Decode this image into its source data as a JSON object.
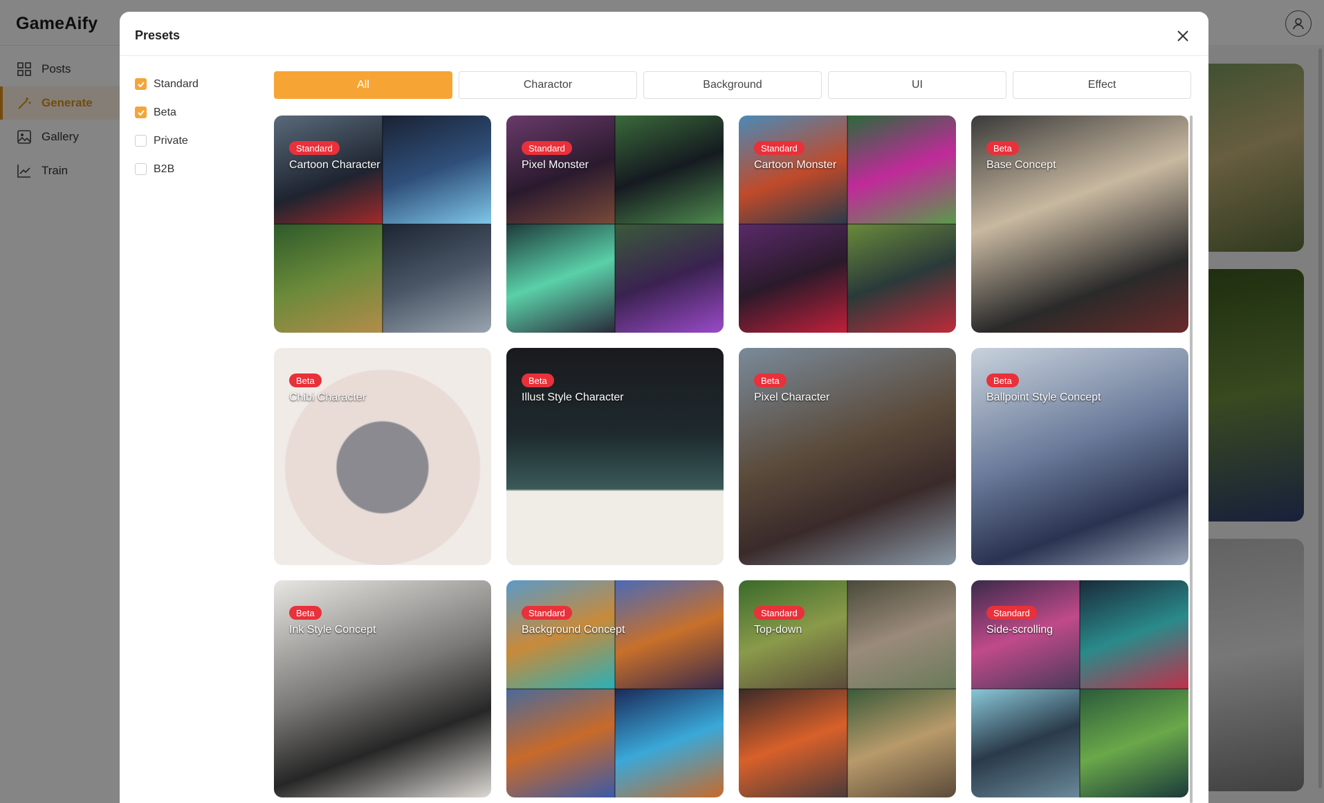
{
  "app": {
    "name": "GameAify"
  },
  "sidebar": {
    "items": [
      {
        "label": "Posts",
        "icon": "grid-icon"
      },
      {
        "label": "Generate",
        "icon": "magic-wand-icon",
        "active": true
      },
      {
        "label": "Gallery",
        "icon": "image-icon"
      },
      {
        "label": "Train",
        "icon": "chart-line-icon"
      }
    ]
  },
  "colors": {
    "accent": "#f6a534",
    "badge": "#e8313a"
  },
  "modal": {
    "title": "Presets",
    "filters": [
      {
        "label": "Standard",
        "checked": true
      },
      {
        "label": "Beta",
        "checked": true
      },
      {
        "label": "Private",
        "checked": false
      },
      {
        "label": "B2B",
        "checked": false
      }
    ],
    "tabs": [
      {
        "label": "All",
        "active": true
      },
      {
        "label": "Charactor"
      },
      {
        "label": "Background"
      },
      {
        "label": "UI"
      },
      {
        "label": "Effect"
      }
    ],
    "presets": [
      {
        "badge": "Standard",
        "title": "Cartoon Character"
      },
      {
        "badge": "Standard",
        "title": "Pixel Monster"
      },
      {
        "badge": "Standard",
        "title": "Cartoon Monster"
      },
      {
        "badge": "Beta",
        "title": "Base Concept"
      },
      {
        "badge": "Beta",
        "title": "Chibi Character"
      },
      {
        "badge": "Beta",
        "title": "Illust Style Character"
      },
      {
        "badge": "Beta",
        "title": "Pixel Character"
      },
      {
        "badge": "Beta",
        "title": "Ballpoint Style Concept"
      },
      {
        "badge": "Beta",
        "title": "Ink Style Concept"
      },
      {
        "badge": "Standard",
        "title": "Background Concept"
      },
      {
        "badge": "Standard",
        "title": "Top-down"
      },
      {
        "badge": "Standard",
        "title": "Side-scrolling"
      }
    ]
  }
}
